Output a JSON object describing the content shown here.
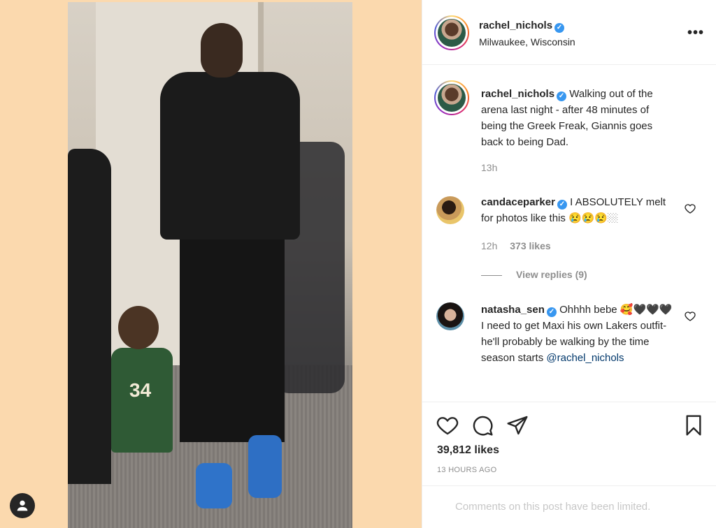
{
  "post": {
    "username": "rachel_nichols",
    "location": "Milwaukee, Wisconsin",
    "caption": "Walking out of the arena last night - after 48 minutes of being the Greek Freak, Giannis goes back to being Dad.",
    "caption_time": "13h",
    "photo_jersey_number": "34"
  },
  "comments": [
    {
      "username": "candaceparker",
      "text": "I ABSOLUTELY melt for photos like this 😢😢😢🏼",
      "time": "12h",
      "likes": "373 likes",
      "view_replies": "View replies (9)"
    },
    {
      "username": "natasha_sen",
      "text": "Ohhhh bebe 🥰🖤🖤🖤 I need to get Maxi his own Lakers outfit- he'll probably be walking by the time season starts",
      "mention": "@rachel_nichols"
    }
  ],
  "actions": {
    "likes": "39,812 likes",
    "time_ago": "13 HOURS AGO"
  },
  "footer": {
    "limited_text": "Comments on this post have been limited."
  },
  "icons": {
    "more": "more-options-icon",
    "heart": "heart-icon",
    "comment": "comment-icon",
    "share": "share-icon",
    "save": "bookmark-icon"
  },
  "colors": {
    "media_bg": "#fbd9ae",
    "verified": "#3897f0",
    "muted": "#8e8e8e"
  }
}
